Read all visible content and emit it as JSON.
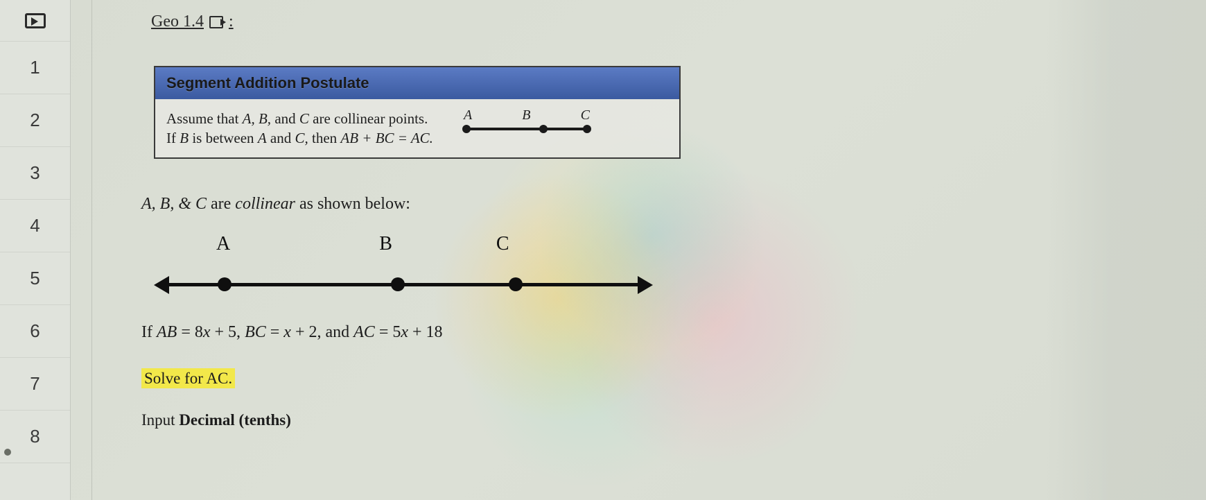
{
  "doc": {
    "title": "Geo 1.4",
    "title_suffix": ":"
  },
  "rows": [
    "1",
    "2",
    "3",
    "4",
    "5",
    "6",
    "7",
    "8"
  ],
  "postulate": {
    "header": "Segment Addition Postulate",
    "line1_prefix": "Assume that ",
    "line1_vars": "A, B,",
    "line1_mid": " and ",
    "line1_varC": "C",
    "line1_suffix": " are collinear points.",
    "line2_prefix": "If ",
    "line2_b": "B",
    "line2_mid": " is between ",
    "line2_a": "A",
    "line2_and": " and ",
    "line2_c": "C,",
    "line2_then": " then ",
    "line2_eq": "AB + BC = AC.",
    "mini_labels": {
      "a": "A",
      "b": "B",
      "c": "C"
    }
  },
  "problem": {
    "intro_vars": "A, B, & C ",
    "intro_mid": "are ",
    "intro_collinear": "collinear",
    "intro_suffix": " as shown below:",
    "labels": {
      "a": "A",
      "b": "B",
      "c": "C"
    },
    "eq_if": "If ",
    "eq_ab": "AB",
    "eq_eq1": " = 8",
    "eq_x1": "x",
    "eq_p5": " + 5, ",
    "eq_bc": "BC",
    "eq_eq2": " = ",
    "eq_x2": "x",
    "eq_p2": " + 2, ",
    "eq_and": "and ",
    "eq_ac": "AC",
    "eq_eq3": " = 5",
    "eq_x3": "x",
    "eq_p18": " + 18",
    "solve": "Solve for AC.",
    "hint_prefix": "Input ",
    "hint_bold": "Decimal (tenths)"
  }
}
